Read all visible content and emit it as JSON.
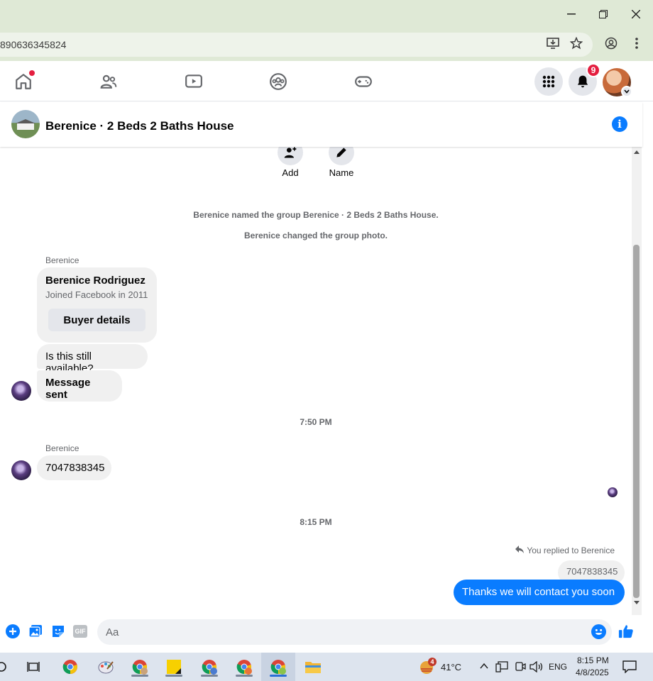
{
  "browser": {
    "url_partial": "890636345824"
  },
  "nav": {
    "notifications_count": "9"
  },
  "chat": {
    "title": "Berenice · 2 Beds 2 Baths House",
    "actions": [
      {
        "label": "Add"
      },
      {
        "label": "Name"
      }
    ],
    "system_messages": [
      "Berenice named the group Berenice · 2 Beds 2 Baths House.",
      "Berenice changed the group photo."
    ],
    "card": {
      "sender": "Berenice",
      "name": "Berenice Rodriguez",
      "joined": "Joined Facebook in 2011",
      "button": "Buyer details"
    },
    "msg_available": "Is this still available?",
    "msg_sent": "Message sent",
    "time_1": "7:50 PM",
    "sender_2": "Berenice",
    "msg_phone": "7047838345",
    "time_2": "8:15 PM",
    "reply_label": "You replied to Berenice",
    "quoted": "7047838345",
    "my_message": "Thanks we will contact you soon"
  },
  "composer": {
    "placeholder": "Aa",
    "gif_label": "GIF"
  },
  "taskbar": {
    "weather_temp": "41°C",
    "weather_badge": "4",
    "language": "ENG",
    "time": "8:15 PM",
    "date": "4/8/2025"
  },
  "colors": {
    "messenger_blue": "#0a7cff",
    "bubble_gray": "#f0f0f0",
    "badge_red": "#e41e3f"
  }
}
